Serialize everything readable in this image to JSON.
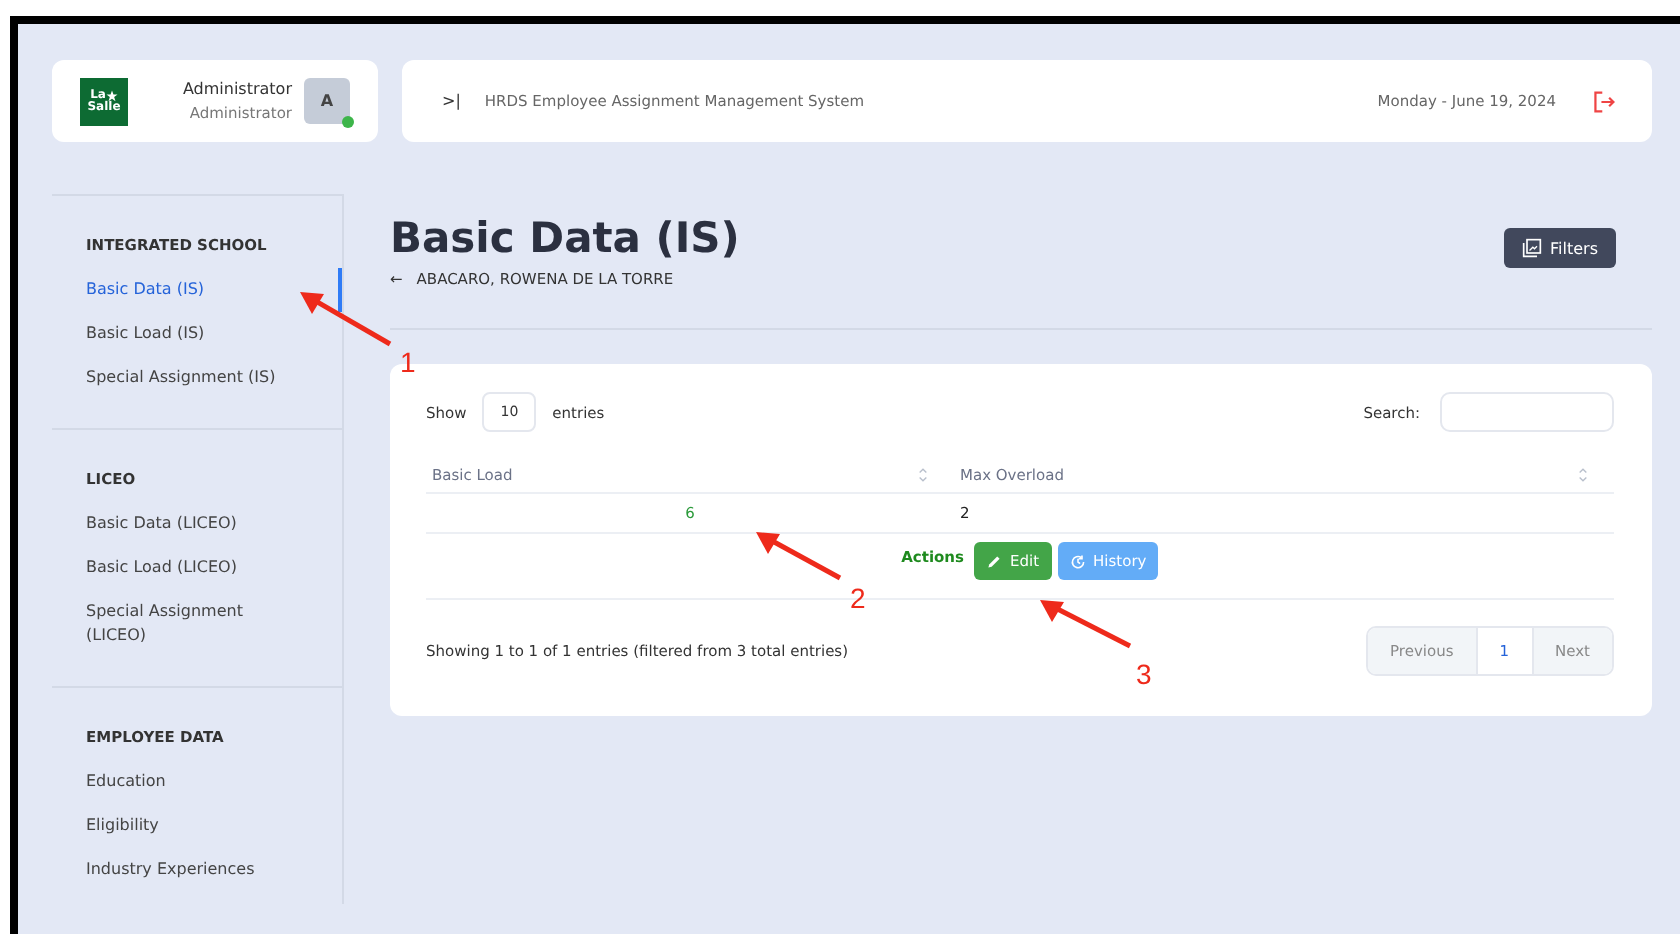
{
  "logo": {
    "line1": "La",
    "line2": "Salle"
  },
  "user": {
    "name": "Administrator",
    "role": "Administrator",
    "initial": "A",
    "online": true
  },
  "topbar": {
    "toggle": ">|",
    "title": "HRDS Employee Assignment Management System",
    "date": "Monday - June 19, 2024"
  },
  "sidebar": {
    "sections": [
      {
        "heading": "INTEGRATED SCHOOL",
        "items": [
          {
            "label": "Basic Data (IS)",
            "selected": true
          },
          {
            "label": "Basic Load (IS)",
            "selected": false
          },
          {
            "label": "Special Assignment (IS)",
            "selected": false
          }
        ]
      },
      {
        "heading": "LICEO",
        "items": [
          {
            "label": "Basic Data (LICEO)",
            "selected": false
          },
          {
            "label": "Basic Load (LICEO)",
            "selected": false
          },
          {
            "label": "Special Assignment (LICEO)",
            "selected": false
          }
        ]
      },
      {
        "heading": "EMPLOYEE DATA",
        "items": [
          {
            "label": "Education",
            "selected": false
          },
          {
            "label": "Eligibility",
            "selected": false
          },
          {
            "label": "Industry Experiences",
            "selected": false
          }
        ]
      }
    ]
  },
  "page": {
    "title": "Basic Data (IS)",
    "back": "←",
    "employee": "ABACARO, ROWENA DE LA TORRE",
    "filters": "Filters"
  },
  "table": {
    "show_label": "Show",
    "page_size": "10",
    "entries_label": "entries",
    "search_label": "Search:",
    "columns": [
      {
        "label": "Basic Load"
      },
      {
        "label": "Max Overload"
      }
    ],
    "rows": [
      {
        "cells": [
          "6",
          "2"
        ]
      }
    ],
    "actions": {
      "label": "Actions",
      "buttons": [
        {
          "kind": "edit",
          "label": "Edit"
        },
        {
          "kind": "history",
          "label": "History"
        }
      ]
    },
    "info": "Showing 1 to 1 of 1 entries (filtered from 3 total entries)",
    "pagination": {
      "previous": "Previous",
      "pages": [
        {
          "label": "1",
          "selected": true
        }
      ],
      "next": "Next"
    }
  },
  "annotations": [
    {
      "number": "1"
    },
    {
      "number": "2"
    },
    {
      "number": "3"
    }
  ]
}
